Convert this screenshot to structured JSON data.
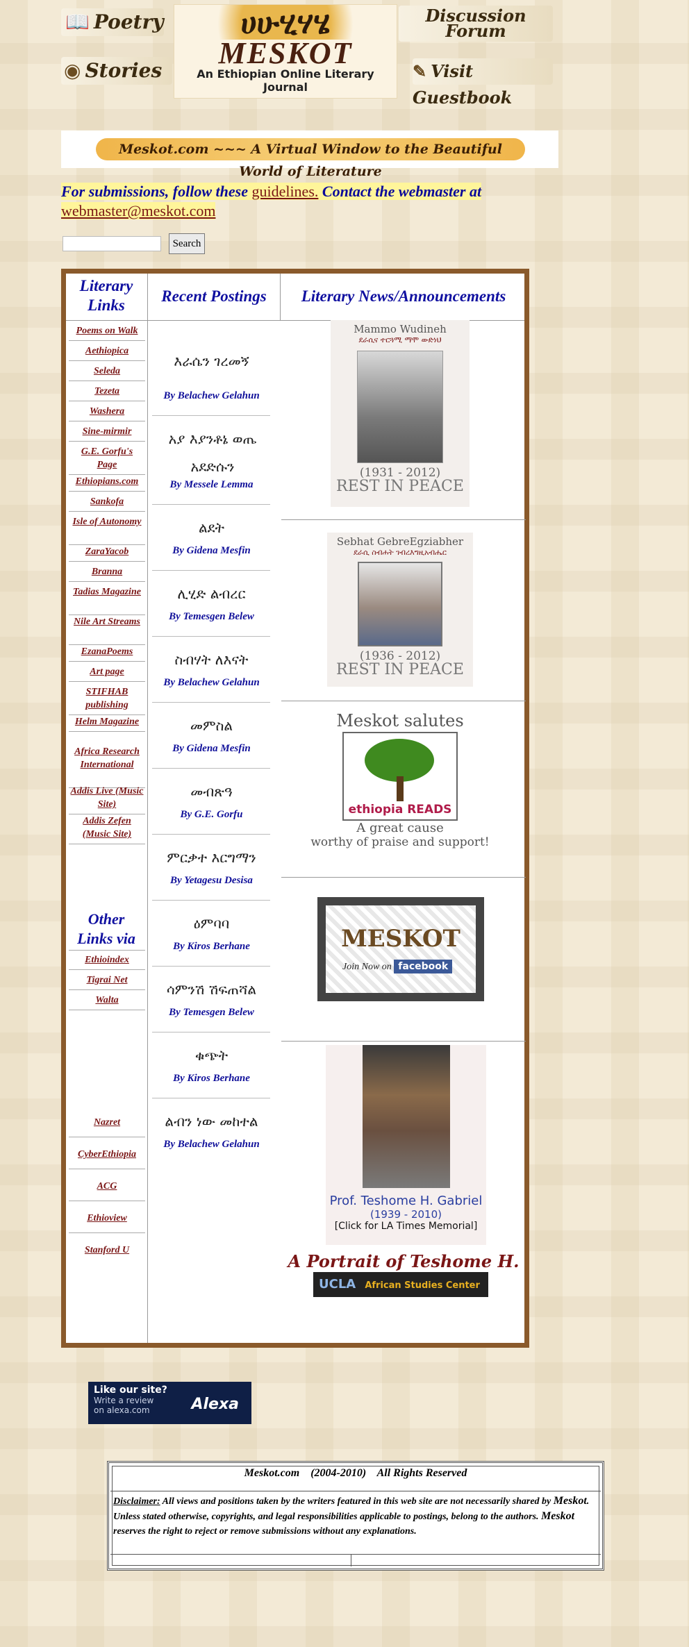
{
  "header": {
    "nav": {
      "poetry": "Poetry",
      "stories": "Stories",
      "discussion_line1": "Discussion",
      "discussion_line2": "Forum",
      "guestbook": "Visit Guestbook"
    },
    "logo": {
      "amharic": "ሀሁሂሃሄ",
      "brand": "MESKOT",
      "subtitle": "An Ethiopian Online Literary Journal"
    }
  },
  "banner": {
    "text": "Meskot.com ~~~ A Virtual Window to the Beautiful World of Literature"
  },
  "submissions": {
    "prefix": "For submissions, follow these",
    "guidelines_link": "guidelines.",
    "middle": "Contact the webmaster at",
    "email_link": "webmaster@meskot.com"
  },
  "search": {
    "placeholder": "",
    "button": "Search"
  },
  "columns": {
    "literary_links": "Literary Links",
    "recent_postings": "Recent Postings",
    "news": "Literary News/Announcements"
  },
  "literary_links": [
    "Poems on Walk",
    "Aethiopica",
    "Seleda",
    "Tezeta",
    "Washera",
    "Sine-mirmir",
    "G.E. Gorfu's Page",
    "Ethiopians.com",
    "Sankofa",
    "Isle of Autonomy",
    "ZaraYacob",
    "Branna",
    "Tadias Magazine",
    "Nile Art Streams",
    "EzanaPoems",
    "Art page",
    "STIFHAB publishing",
    "Helm Magazine",
    "Africa Research International",
    "Addis Live (Music Site)",
    "Addis Zefen (Music Site)"
  ],
  "other_links": {
    "title": "Other Links via",
    "items": [
      "Ethioindex",
      "Tigrai Net",
      "Walta"
    ]
  },
  "more_links": [
    "Nazret",
    "CyberEthiopia",
    "ACG",
    "Ethioview",
    "Stanford U"
  ],
  "postings": [
    {
      "title": "እራሴን ገረመኝ",
      "author": "By Belachew Gelahun"
    },
    {
      "title": "አያ እያንቶኔ ወጤ አደድሱን",
      "author": "By Messele Lemma"
    },
    {
      "title": "ልደት",
      "author": "By Gidena Mesfin"
    },
    {
      "title": "ሊሂድ ልብረር",
      "author": "By Temesgen Belew"
    },
    {
      "title": "ስብሃት ለእናት",
      "author": "By Belachew Gelahun"
    },
    {
      "title": "መምስል",
      "author": "By Gidena Mesfin"
    },
    {
      "title": "መብጽዓ",
      "author": "By G.E. Gorfu"
    },
    {
      "title": "ምርቃተ እርግማን",
      "author": "By Yetagesu Desisa"
    },
    {
      "title": "ዕምባባ",
      "author": "By Kiros Berhane"
    },
    {
      "title": "ሳምንሽ ሽፍጠሻል",
      "author": "By Temesgen Belew"
    },
    {
      "title": "ቁጭት",
      "author": "By Kiros Berhane"
    },
    {
      "title": "ልብን ነው መከተል",
      "author": "By Belachew Gelahun"
    }
  ],
  "news": {
    "mammo": {
      "name": "Mammo Wudineh",
      "amharic": "ደራሲና ተርጓሚ ማሞ ውድነህ",
      "years": "(1931 - 2012)",
      "rip": "REST IN PEACE"
    },
    "sebhat": {
      "name": "Sebhat GebreEgziabher",
      "amharic": "ደራሲ ስብሐት ገብረእግዚአብሔር",
      "years": "(1936 - 2012)",
      "rip": "REST IN PEACE"
    },
    "salute": {
      "title": "Meskot salutes",
      "logo": "ethiopia READS",
      "line1": "A great cause",
      "line2": "worthy of praise and support!"
    },
    "facebook": {
      "brand": "MESKOT",
      "join": "Join Now on",
      "fb": "facebook"
    },
    "teshome": {
      "name": "Prof. Teshome H. Gabriel",
      "years": "(1939 - 2010)",
      "click": "[Click for LA Times Memorial]"
    },
    "portrait": {
      "title": "A Portrait of Teshome H. Gabriel",
      "ucla": "UCLA",
      "center": "African Studies Center"
    }
  },
  "alexa": {
    "line1": "Like our site?",
    "line2": "Write a review",
    "line3": "on alexa.com",
    "logo": "Alexa"
  },
  "footer": {
    "copyright": "Meskot.com    (2004-2010)    All Rights Reserved",
    "disclaimer_label": "Disclaimer:",
    "disclaimer_1": " All views and positions taken by the writers featured in this web site are not necessarily shared by ",
    "brand1": "Meskot",
    "disclaimer_2": ". Unless stated otherwise, copyrights, and legal responsibilities applicable to postings, belong to the authors. ",
    "brand2": "Meskot",
    "disclaimer_3": " reserves the right to reject or remove submissions without any explanations."
  },
  "colors": {
    "frame": "#8a5a2b",
    "link": "#7a1616",
    "heading": "#1010a0",
    "highlight": "#fff59a"
  }
}
